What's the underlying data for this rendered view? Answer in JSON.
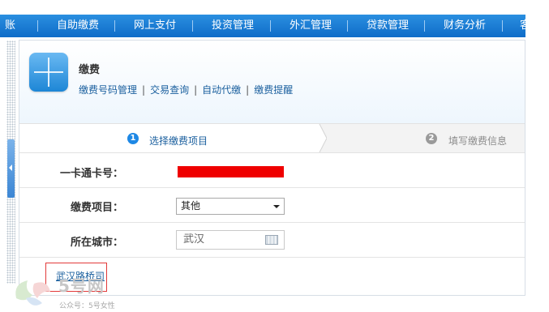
{
  "topnav": {
    "items": [
      "账",
      "自助缴费",
      "网上支付",
      "投资管理",
      "外汇管理",
      "贷款管理",
      "财务分析",
      "客"
    ]
  },
  "header": {
    "title": "缴费",
    "subnav": [
      "缴费号码管理",
      "交易查询",
      "自动代缴",
      "缴费提醒"
    ],
    "separator": "|"
  },
  "steps": [
    {
      "number": "1",
      "label": "选择缴费项目",
      "active": true
    },
    {
      "number": "2",
      "label": "填写缴费信息",
      "active": false
    }
  ],
  "form": {
    "card_label": "一卡通卡号：",
    "item_label": "缴费项目：",
    "item_value": "其他",
    "city_label": "所在城市：",
    "city_value": "武汉"
  },
  "bottom_link": "武汉路桥司",
  "watermark": {
    "text": "5号网",
    "sub": "公众号：5号女性"
  },
  "colors": {
    "nav_blue": "#1577d0",
    "link_blue": "#1a5f9e",
    "redaction": "#ef0000",
    "step_active": "#1e88e5",
    "step_inactive": "#9a9a9a"
  }
}
